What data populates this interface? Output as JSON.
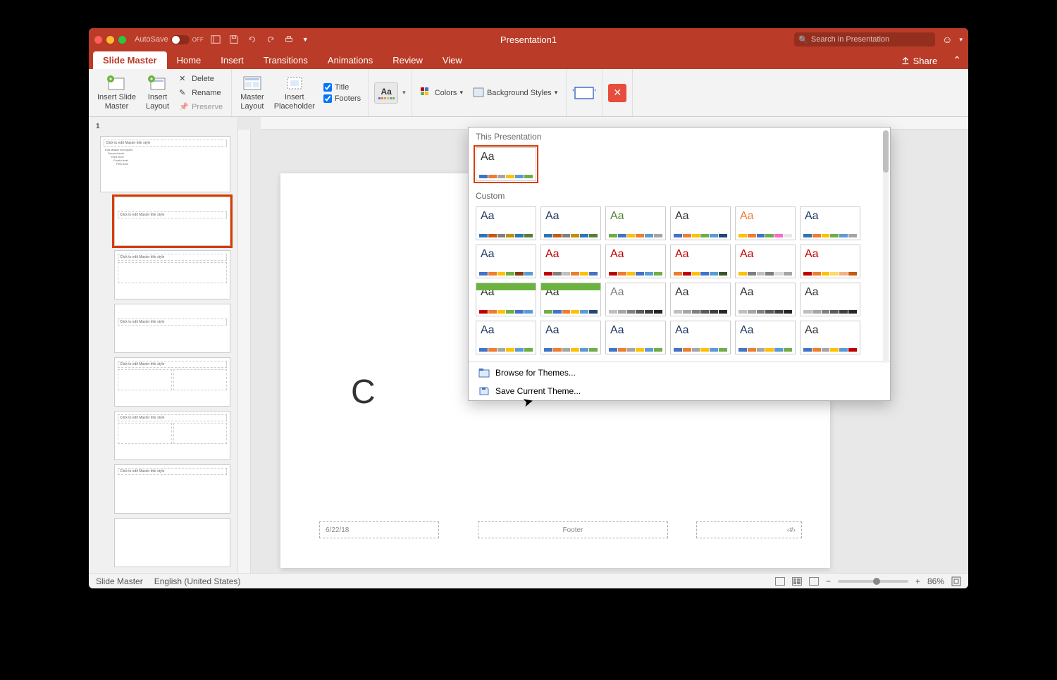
{
  "titlebar": {
    "autosave_label": "AutoSave",
    "autosave_state": "OFF",
    "title": "Presentation1",
    "search_placeholder": "Search in Presentation"
  },
  "tabs": {
    "items": [
      "Slide Master",
      "Home",
      "Insert",
      "Transitions",
      "Animations",
      "Review",
      "View"
    ],
    "active": 0,
    "share": "Share"
  },
  "ribbon": {
    "insert_slide_master": "Insert Slide\nMaster",
    "insert_layout": "Insert\nLayout",
    "delete": "Delete",
    "rename": "Rename",
    "preserve": "Preserve",
    "master_layout": "Master\nLayout",
    "insert_placeholder": "Insert\nPlaceholder",
    "chk_title": "Title",
    "chk_footers": "Footers",
    "colors": "Colors",
    "bg_styles": "Background Styles",
    "close": "✕"
  },
  "themes_popup": {
    "section1": "This Presentation",
    "section2": "Custom",
    "browse": "Browse for Themes...",
    "save": "Save Current Theme...",
    "tiles_row1": [
      {
        "aa_color": "#333",
        "colors": [
          "#4472c4",
          "#ed7d31",
          "#a5a5a5",
          "#ffc000",
          "#5b9bd5",
          "#70ad47"
        ]
      }
    ],
    "tiles_custom": [
      {
        "aa_color": "#1f3864",
        "colors": [
          "#2e75b6",
          "#c55a11",
          "#7f7f7f",
          "#bf9000",
          "#2e75b6",
          "#548235"
        ]
      },
      {
        "aa_color": "#1f3864",
        "colors": [
          "#2e75b6",
          "#c55a11",
          "#7f7f7f",
          "#bf9000",
          "#2e75b6",
          "#548235"
        ]
      },
      {
        "aa_color": "#548235",
        "colors": [
          "#70ad47",
          "#4472c4",
          "#ffc000",
          "#ed7d31",
          "#5b9bd5",
          "#a5a5a5"
        ]
      },
      {
        "aa_color": "#333",
        "colors": [
          "#4472c4",
          "#ed7d31",
          "#ffc000",
          "#70ad47",
          "#5b9bd5",
          "#264478"
        ]
      },
      {
        "aa_color": "#ed7d31",
        "colors": [
          "#ffc000",
          "#ed7d31",
          "#4472c4",
          "#70ad47",
          "#ff66cc",
          "#e7e6e6"
        ]
      },
      {
        "aa_color": "#1f3864",
        "colors": [
          "#2e75b6",
          "#ed7d31",
          "#ffc000",
          "#70ad47",
          "#5b9bd5",
          "#a5a5a5"
        ]
      },
      {
        "aa_color": "#1f3864",
        "colors": [
          "#4472c4",
          "#ed7d31",
          "#ffc000",
          "#70ad47",
          "#843c0c",
          "#5b9bd5"
        ]
      },
      {
        "aa_color": "#c00000",
        "colors": [
          "#c00000",
          "#7f7f7f",
          "#bfbfbf",
          "#ed7d31",
          "#ffc000",
          "#4472c4"
        ]
      },
      {
        "aa_color": "#c00000",
        "colors": [
          "#c00000",
          "#ed7d31",
          "#ffc000",
          "#4472c4",
          "#5b9bd5",
          "#70ad47"
        ]
      },
      {
        "aa_color": "#c00000",
        "colors": [
          "#ed7d31",
          "#c00000",
          "#ffc000",
          "#4472c4",
          "#5b9bd5",
          "#375623"
        ]
      },
      {
        "aa_color": "#c00000",
        "colors": [
          "#ffc000",
          "#7f7f7f",
          "#bfbfbf",
          "#7f7f7f",
          "#d9d9d9",
          "#a5a5a5"
        ]
      },
      {
        "aa_color": "#c00000",
        "colors": [
          "#c00000",
          "#ed7d31",
          "#ffc000",
          "#ffd966",
          "#f4b183",
          "#c55a11"
        ]
      },
      {
        "aa_color": "#333",
        "greenhead": true,
        "colors": [
          "#c00000",
          "#ed7d31",
          "#ffc000",
          "#70ad47",
          "#4472c4",
          "#5b9bd5"
        ]
      },
      {
        "aa_color": "#333",
        "greenhead": true,
        "colors": [
          "#70ad47",
          "#4472c4",
          "#ed7d31",
          "#ffc000",
          "#5b9bd5",
          "#264478"
        ]
      },
      {
        "aa_color": "#7f7f7f",
        "colors": [
          "#bfbfbf",
          "#a5a5a5",
          "#7f7f7f",
          "#595959",
          "#404040",
          "#262626"
        ]
      },
      {
        "aa_color": "#333",
        "colors": [
          "#bfbfbf",
          "#a5a5a5",
          "#7f7f7f",
          "#595959",
          "#404040",
          "#262626"
        ]
      },
      {
        "aa_color": "#333",
        "colors": [
          "#bfbfbf",
          "#a5a5a5",
          "#7f7f7f",
          "#595959",
          "#404040",
          "#262626"
        ]
      },
      {
        "aa_color": "#333",
        "colors": [
          "#bfbfbf",
          "#a5a5a5",
          "#7f7f7f",
          "#595959",
          "#404040",
          "#262626"
        ]
      },
      {
        "aa_color": "#1f3864",
        "colors": [
          "#4472c4",
          "#ed7d31",
          "#a5a5a5",
          "#ffc000",
          "#5b9bd5",
          "#70ad47"
        ]
      },
      {
        "aa_color": "#1f3864",
        "colors": [
          "#4472c4",
          "#ed7d31",
          "#a5a5a5",
          "#ffc000",
          "#5b9bd5",
          "#70ad47"
        ]
      },
      {
        "aa_color": "#1f3864",
        "colors": [
          "#4472c4",
          "#ed7d31",
          "#a5a5a5",
          "#ffc000",
          "#5b9bd5",
          "#70ad47"
        ]
      },
      {
        "aa_color": "#1f3864",
        "colors": [
          "#4472c4",
          "#ed7d31",
          "#a5a5a5",
          "#ffc000",
          "#5b9bd5",
          "#70ad47"
        ]
      },
      {
        "aa_color": "#1f3864",
        "colors": [
          "#4472c4",
          "#ed7d31",
          "#a5a5a5",
          "#ffc000",
          "#5b9bd5",
          "#70ad47"
        ]
      },
      {
        "aa_color": "#333",
        "colors": [
          "#4472c4",
          "#ed7d31",
          "#a5a5a5",
          "#ffc000",
          "#5b9bd5",
          "#c00000"
        ]
      }
    ]
  },
  "side_thumbs": {
    "number": "1",
    "master_title": "Click to edit Master title style",
    "master_bullets": [
      "Edit Master text styles",
      "Second level",
      "Third level",
      "Fourth level",
      "Fifth level"
    ],
    "layouts": [
      "Click to edit Master title style",
      "Click to edit Master title style",
      "Click to edit Master title style",
      "Click to edit Master title style",
      "Click to edit Master title style",
      "Click to edit Master title style",
      ""
    ],
    "selected_index": 0
  },
  "canvas": {
    "title_fragment": "C",
    "date": "6/22/18",
    "footer": "Footer",
    "pagenum": "‹#›"
  },
  "statusbar": {
    "view_label": "Slide Master",
    "language": "English (United States)",
    "zoom": "86%"
  }
}
